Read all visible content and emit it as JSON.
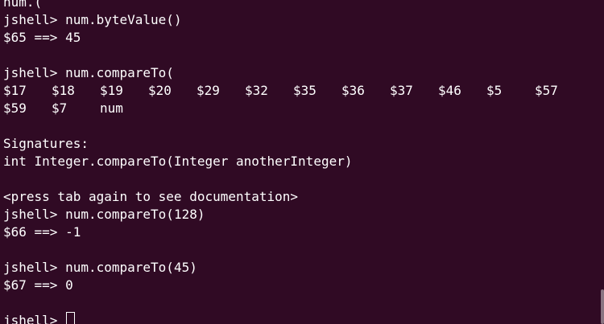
{
  "terminal": {
    "prompt": "jshell>",
    "lines": {
      "l0": "num.(",
      "l1_cmd": "num.byteValue()",
      "l2": "$65 ==> 45",
      "l4_cmd": "num.compareTo(",
      "completions_row1": [
        "$17",
        "$18",
        "$19",
        "$20",
        "$29",
        "$32",
        "$35",
        "$36",
        "$37",
        "$46",
        "$5",
        "$57"
      ],
      "completions_row2": [
        "$59",
        "$7",
        "num"
      ],
      "signatures_header": "Signatures:",
      "signature": "int Integer.compareTo(Integer anotherInteger)",
      "press_tab": "<press tab again to see documentation>",
      "l12_cmd": "num.compareTo(128)",
      "l13": "$66 ==> -1",
      "l15_cmd": "num.compareTo(45)",
      "l16": "$67 ==> 0"
    }
  },
  "colors": {
    "background": "#300a24",
    "foreground": "#ffffff"
  }
}
